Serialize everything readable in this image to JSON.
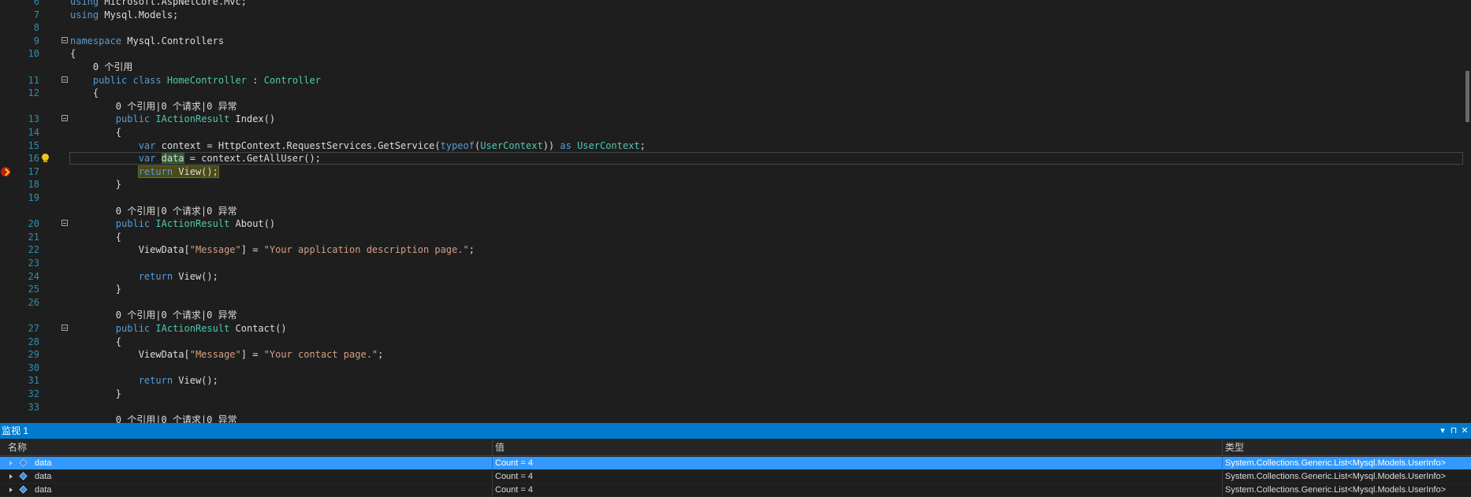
{
  "editor": {
    "lines": [
      {
        "n": "6",
        "text": "using Microsoft.AspNetCore.Mvc;"
      },
      {
        "n": "7",
        "text": "using Mysql.Models;"
      },
      {
        "n": "8",
        "text": ""
      },
      {
        "n": "9",
        "text": "namespace Mysql.Controllers"
      },
      {
        "n": "10",
        "text": "{"
      },
      {
        "n": "",
        "text": "    0 个引用"
      },
      {
        "n": "11",
        "text": "    public class HomeController : Controller"
      },
      {
        "n": "12",
        "text": "    {"
      },
      {
        "n": "",
        "text": "        0 个引用|0 个请求|0 异常"
      },
      {
        "n": "13",
        "text": "        public IActionResult Index()"
      },
      {
        "n": "14",
        "text": "        {"
      },
      {
        "n": "15",
        "text": "            var context = HttpContext.RequestServices.GetService(typeof(UserContext)) as UserContext;"
      },
      {
        "n": "16",
        "text": "            var data = context.GetAllUser();"
      },
      {
        "n": "17",
        "text": "            return View();"
      },
      {
        "n": "18",
        "text": "        }"
      },
      {
        "n": "19",
        "text": ""
      },
      {
        "n": "",
        "text": "        0 个引用|0 个请求|0 异常"
      },
      {
        "n": "20",
        "text": "        public IActionResult About()"
      },
      {
        "n": "21",
        "text": "        {"
      },
      {
        "n": "22",
        "text": "            ViewData[\"Message\"] = \"Your application description page.\";"
      },
      {
        "n": "23",
        "text": ""
      },
      {
        "n": "24",
        "text": "            return View();"
      },
      {
        "n": "25",
        "text": "        }"
      },
      {
        "n": "26",
        "text": ""
      },
      {
        "n": "",
        "text": "        0 个引用|0 个请求|0 异常"
      },
      {
        "n": "27",
        "text": "        public IActionResult Contact()"
      },
      {
        "n": "28",
        "text": "        {"
      },
      {
        "n": "29",
        "text": "            ViewData[\"Message\"] = \"Your contact page.\";"
      },
      {
        "n": "30",
        "text": ""
      },
      {
        "n": "31",
        "text": "            return View();"
      },
      {
        "n": "32",
        "text": "        }"
      },
      {
        "n": "33",
        "text": ""
      },
      {
        "n": "",
        "text": "        0 个引用|0 个请求|0 异常"
      }
    ],
    "current_line": "16",
    "execution_line": "17"
  },
  "watch": {
    "title": "监视 1",
    "columns": {
      "name": "名称",
      "value": "值",
      "type": "类型"
    },
    "rows": [
      {
        "name": "data",
        "value": "Count = 4",
        "type": "System.Collections.Generic.List<Mysql.Models.UserInfo>",
        "selected": true
      },
      {
        "name": "data",
        "value": "Count = 4",
        "type": "System.Collections.Generic.List<Mysql.Models.UserInfo>",
        "selected": false
      },
      {
        "name": "data",
        "value": "Count = 4",
        "type": "System.Collections.Generic.List<Mysql.Models.UserInfo>",
        "selected": false
      }
    ],
    "buttons": {
      "dropdown": "▾",
      "pin": "⊓",
      "close": "✕"
    }
  },
  "colors": {
    "accent": "#007acc",
    "selection": "#3399ff",
    "breakpoint": "#c51919"
  }
}
